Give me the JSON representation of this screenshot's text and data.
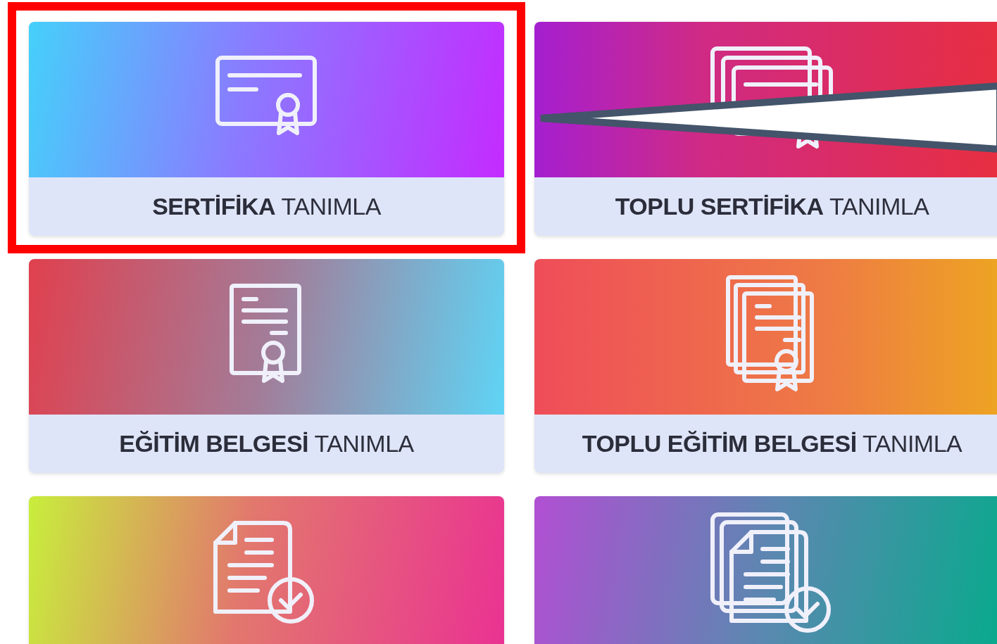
{
  "cards": [
    {
      "kind": "certificate",
      "label": "**SERTİFİKA** TANIMLA",
      "highlighted": true
    },
    {
      "kind": "certificate-stack",
      "label": "**TOPLU SERTİFİKA** TANIMLA"
    },
    {
      "kind": "document-certificate",
      "label": "**EĞİTİM BELGESİ** TANIMLA"
    },
    {
      "kind": "document-certificate-stack",
      "label": "**TOPLU EĞİTİM BELGESİ** TANIMLA"
    },
    {
      "kind": "document-check"
    },
    {
      "kind": "document-check-stack"
    }
  ],
  "pointer_arrow": true
}
